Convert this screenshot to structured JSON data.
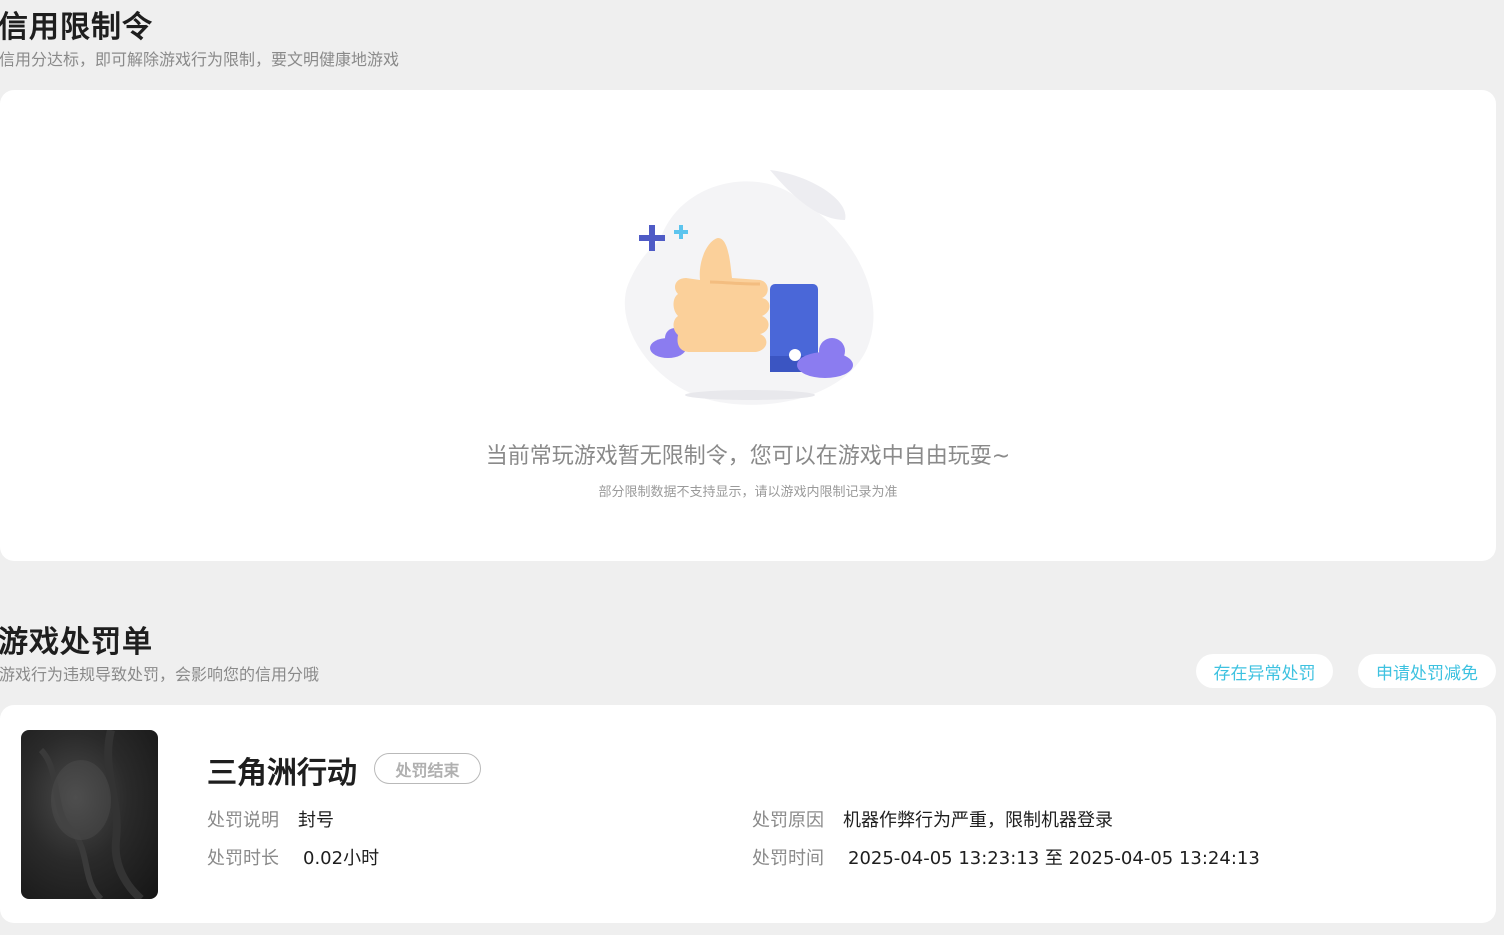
{
  "limits": {
    "title": "信用限制令",
    "subtitle": "信用分达标，即可解除游戏行为限制，要文明健康地游戏",
    "empty_message": "当前常玩游戏暂无限制令，您可以在游戏中自由玩耍~",
    "empty_note": "部分限制数据不支持显示，请以游戏内限制记录为准"
  },
  "penalties": {
    "title": "游戏处罚单",
    "subtitle": "游戏行为违规导致处罚，会影响您的信用分哦",
    "abnormal_button": "存在异常处罚",
    "reduce_button": "申请处罚减免",
    "record": {
      "game_name": "三角洲行动",
      "status": "处罚结束",
      "desc_label": "处罚说明",
      "desc_value": "封号",
      "duration_label": "处罚时长",
      "duration_value": "0.02小时",
      "reason_label": "处罚原因",
      "reason_value": "机器作弊行为严重，限制机器登录",
      "time_label": "处罚时间",
      "time_value": "2025-04-05 13:23:13 至 2025-04-05 13:24:13"
    }
  },
  "colors": {
    "accent": "#3ec2e0",
    "page_bg": "#efefef",
    "card_bg": "#ffffff"
  }
}
